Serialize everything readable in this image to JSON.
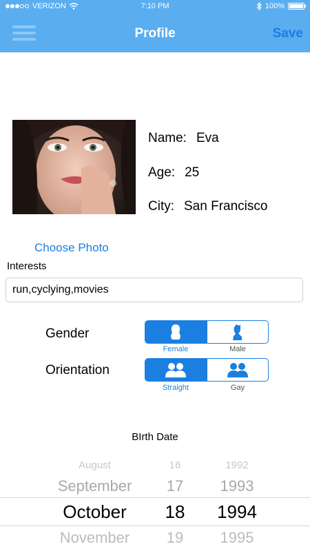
{
  "status_bar": {
    "carrier": "VERIZON",
    "time": "7:10 PM",
    "battery": "100%"
  },
  "nav": {
    "title": "Profile",
    "save_label": "Save",
    "menu_icon": "hamburger-menu-icon"
  },
  "profile": {
    "name_label": "Name:",
    "name": "Eva",
    "age_label": "Age:",
    "age": "25",
    "city_label": "City:",
    "city": "San Francisco",
    "choose_photo": "Choose Photo"
  },
  "interests": {
    "label": "Interests",
    "value": "run,cyclying,movies"
  },
  "gender": {
    "label": "Gender",
    "options": [
      "Female",
      "Male"
    ],
    "selected": "Female"
  },
  "orientation": {
    "label": "Orientation",
    "options": [
      "Straight",
      "Gay"
    ],
    "selected": "Straight"
  },
  "birth_date": {
    "label": "BIrth Date",
    "months": [
      "August",
      "September",
      "October",
      "November"
    ],
    "days": [
      "16",
      "17",
      "18",
      "19"
    ],
    "years": [
      "1992",
      "1993",
      "1994",
      "1995"
    ],
    "selected": {
      "month": "October",
      "day": "18",
      "year": "1994"
    }
  },
  "colors": {
    "nav_bg": "#5aaef0",
    "accent": "#1a7fe0"
  }
}
